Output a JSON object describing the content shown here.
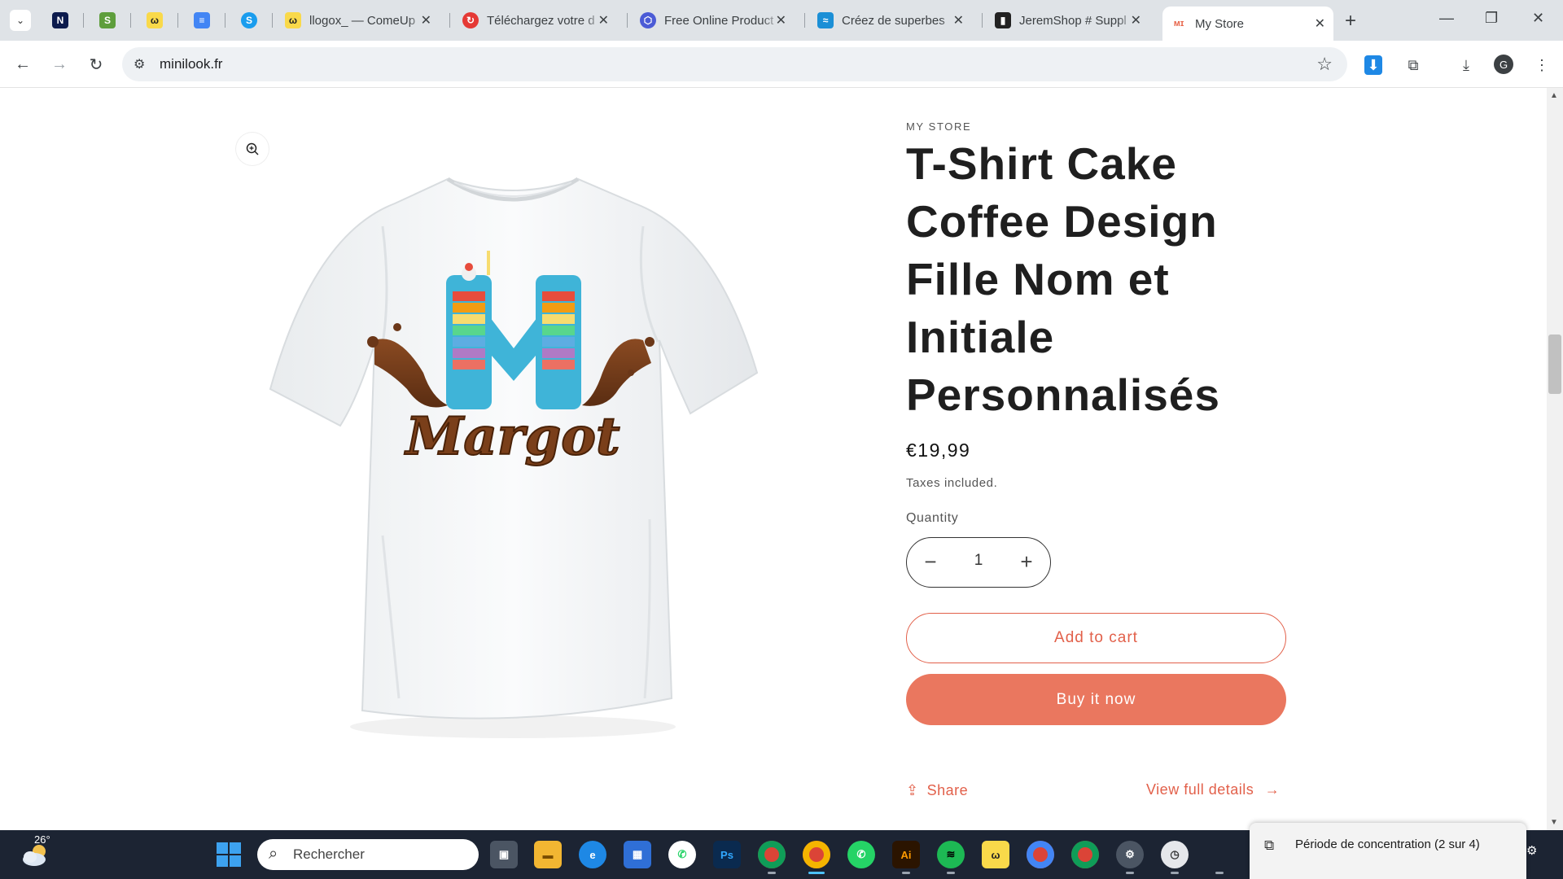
{
  "browser": {
    "tabs": [
      {
        "title": "llogox_ — ComeUp",
        "favicon": "comeup-icon",
        "color": "#f9d94a"
      },
      {
        "title": "Téléchargez votre d",
        "favicon": "download-red-icon",
        "color": "#e53935"
      },
      {
        "title": "Free Online Product",
        "favicon": "hexagon-icon",
        "color": "#4b5bd6"
      },
      {
        "title": "Créez de superbes",
        "favicon": "layers-icon",
        "color": "#1b8fd6"
      },
      {
        "title": "JeremShop # Suppl",
        "favicon": "bottle-icon",
        "color": "#222222"
      },
      {
        "title": "My Store",
        "favicon": "store-icon",
        "color": "#e8684e"
      }
    ],
    "pinned": [
      {
        "name": "n-icon",
        "glyph": "N",
        "color": "#0c1b4d"
      },
      {
        "name": "shopify-icon",
        "glyph": "S",
        "color": "#5e9e3c"
      },
      {
        "name": "comeup-icon",
        "glyph": "ω",
        "color": "#f9d94a"
      },
      {
        "name": "docs-icon",
        "glyph": "≡",
        "color": "#4285f4"
      },
      {
        "name": "skype-icon",
        "glyph": "S",
        "color": "#1a9dee"
      }
    ],
    "url": "minilook.fr",
    "profile_initial": "G"
  },
  "product": {
    "vendor": "MY STORE",
    "title": "T-Shirt Cake Coffee Design Fille Nom et Initiale Personnalisés",
    "print_initial": "M",
    "print_name": "Margot",
    "price": "€19,99",
    "tax_note": "Taxes included.",
    "quantity_label": "Quantity",
    "quantity": "1",
    "add_to_cart": "Add to cart",
    "buy_now": "Buy it now",
    "share": "Share",
    "view_details": "View full details"
  },
  "taskbar": {
    "temperature": "26°",
    "search_placeholder": "Rechercher",
    "notification": "Période de concentration (2 sur 4)",
    "apps": [
      {
        "name": "task-view-icon",
        "glyph": "▣",
        "color": "#6b7280"
      },
      {
        "name": "file-explorer-icon",
        "glyph": "▬",
        "color": "#f2b632"
      },
      {
        "name": "edge-icon",
        "glyph": "e",
        "color": "#1e88e5"
      },
      {
        "name": "store-app-icon",
        "glyph": "▦",
        "color": "#2f6fd6"
      },
      {
        "name": "whatsapp-icon",
        "glyph": "✆",
        "color": "#25d366"
      },
      {
        "name": "photoshop-icon",
        "glyph": "Ps",
        "color": "#0a2a4f"
      },
      {
        "name": "chrome-icon",
        "glyph": "●",
        "color": "#db4437"
      },
      {
        "name": "chrome-profile-icon",
        "glyph": "●",
        "color": "#db4437"
      },
      {
        "name": "whatsapp-desktop-icon",
        "glyph": "✆",
        "color": "#25d366"
      },
      {
        "name": "illustrator-icon",
        "glyph": "Ai",
        "color": "#2b1400"
      },
      {
        "name": "spotify-icon",
        "glyph": "≋",
        "color": "#1db954"
      },
      {
        "name": "comeup-app-icon",
        "glyph": "ω",
        "color": "#f9d94a"
      },
      {
        "name": "chrome-2-icon",
        "glyph": "●",
        "color": "#db4437"
      },
      {
        "name": "chrome-3-icon",
        "glyph": "●",
        "color": "#db4437"
      },
      {
        "name": "settings-icon",
        "glyph": "⚙",
        "color": "#6b7280"
      },
      {
        "name": "clock-icon",
        "glyph": "◷",
        "color": "#9ca3af"
      }
    ]
  }
}
